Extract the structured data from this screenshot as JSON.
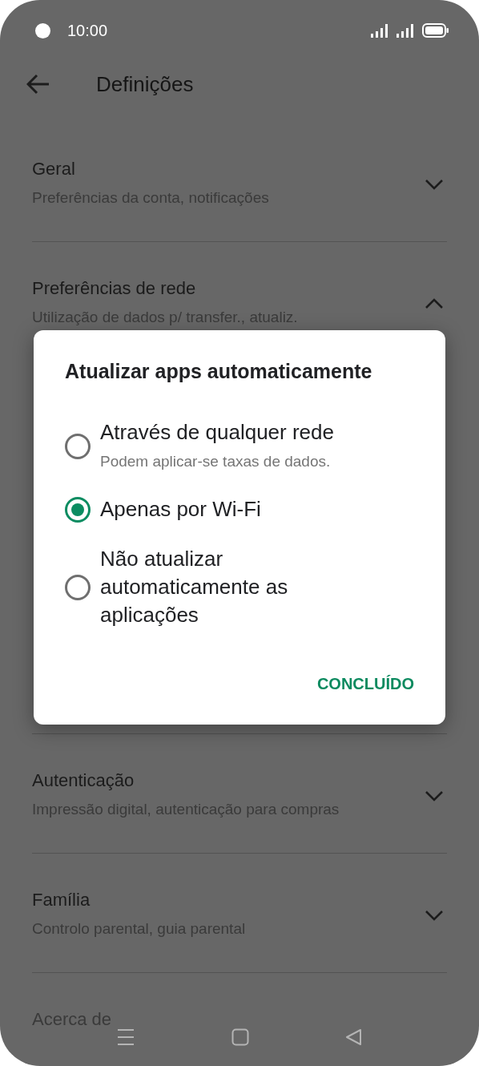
{
  "status_bar": {
    "time": "10:00"
  },
  "header": {
    "title": "Definições"
  },
  "sections": [
    {
      "title": "Geral",
      "subtitle": "Preferências da conta, notificações",
      "expanded": false
    },
    {
      "title": "Preferências de rede",
      "subtitle": "Utilização de dados p/ transfer., atualiz.",
      "expanded": true
    },
    {
      "title": "Autenticação",
      "subtitle": "Impressão digital, autenticação para compras",
      "expanded": false
    },
    {
      "title": "Família",
      "subtitle": "Controlo parental, guia parental",
      "expanded": false
    },
    {
      "title": "Acerca de"
    }
  ],
  "dialog": {
    "title": "Atualizar apps automaticamente",
    "options": [
      {
        "label": "Através de qualquer rede",
        "hint": "Podem aplicar-se taxas de dados.",
        "selected": false
      },
      {
        "label": "Apenas por Wi-Fi",
        "selected": true
      },
      {
        "label": "Não atualizar automaticamente as aplicações",
        "selected": false
      }
    ],
    "button": "CONCLUÍDO"
  }
}
